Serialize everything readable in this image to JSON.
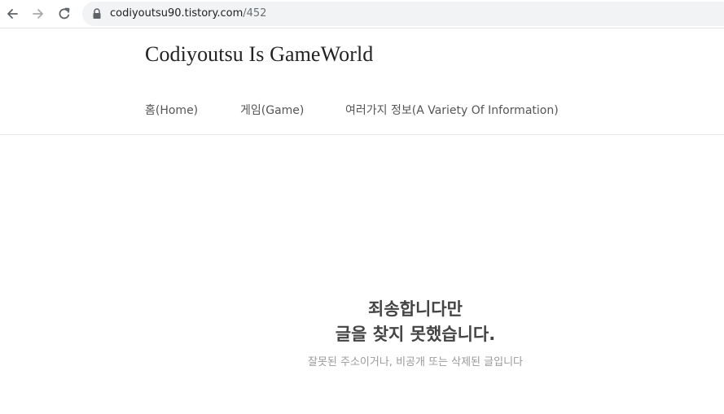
{
  "browser": {
    "url_host": "codiyoutsu90.tistory.com",
    "url_path": "/452"
  },
  "site": {
    "title": "Codiyoutsu Is GameWorld",
    "nav": [
      {
        "label": "홈(Home)"
      },
      {
        "label": "게임(Game)"
      },
      {
        "label": "여러가지 정보(A Variety Of Information)"
      }
    ]
  },
  "error": {
    "title_line1": "죄송합니다만",
    "title_line2": "글을 찾지 못했습니다.",
    "message": "잘못된 주소이거나, 비공개 또는 삭제된 글입니다"
  },
  "colors": {
    "title_text": "#222222",
    "nav_text": "#555555",
    "error_title": "#444444",
    "error_message": "#999999",
    "omnibox_bg": "#f1f3f4"
  },
  "icons": [
    "back-arrow-icon",
    "forward-arrow-icon",
    "reload-icon",
    "lock-icon"
  ]
}
